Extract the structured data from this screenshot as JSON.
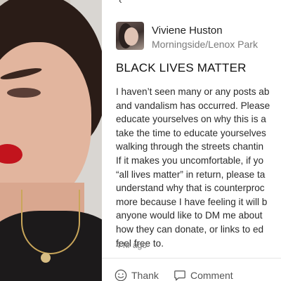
{
  "post": {
    "author_name": "Viviene Huston",
    "author_location": "Morningside/Lenox Park",
    "title": "BLACK LIVES MATTER",
    "body_lines": [
      "I haven’t seen many or any posts ab",
      "and vandalism has occurred. Please",
      "educate yourselves on why this is a",
      "take the time to educate yourselves",
      "walking through the streets chantin",
      "If it makes you uncomfortable, if yo",
      "“all lives matter” in return, please ta",
      "understand why that is counterproc",
      "more because I have feeling it will b",
      "anyone would like to DM me about",
      "how they can donate, or links to ed",
      "feel free to."
    ],
    "timestamp": "4 hr ago"
  },
  "actions": {
    "thank_label": "Thank",
    "comment_label": "Comment"
  },
  "icons": {
    "thank": "smiley-icon",
    "comment": "speech-bubble-icon"
  }
}
